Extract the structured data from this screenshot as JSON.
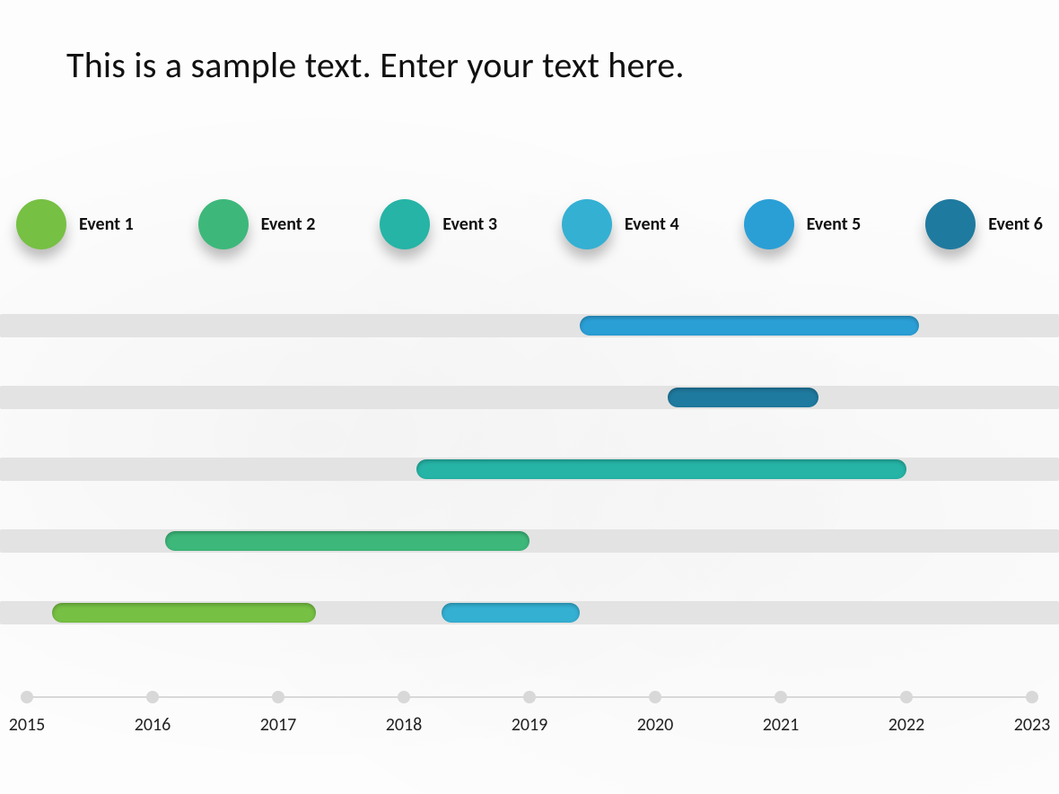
{
  "title": "This is a sample text. Enter your text here.",
  "legend": [
    {
      "label": "Event 1",
      "color": "#76c043"
    },
    {
      "label": "Event 2",
      "color": "#3db87a"
    },
    {
      "label": "Event 3",
      "color": "#25b4a6"
    },
    {
      "label": "Event 4",
      "color": "#34b0d3"
    },
    {
      "label": "Event 5",
      "color": "#2a9fd6"
    },
    {
      "label": "Event 6",
      "color": "#1f7a9f"
    }
  ],
  "axis": {
    "start": 2015,
    "end": 2023,
    "labels": [
      "2015",
      "2016",
      "2017",
      "2018",
      "2019",
      "2020",
      "2021",
      "2022",
      "2023"
    ]
  },
  "chart_data": {
    "type": "bar",
    "title": "This is a sample text. Enter your text here.",
    "xlabel": "",
    "ylabel": "",
    "x_range": [
      2015,
      2023
    ],
    "series": [
      {
        "row": 1,
        "segments": [
          {
            "event": "Event 5",
            "start": 2019.4,
            "end": 2022.1,
            "color": "#2a9fd6"
          }
        ]
      },
      {
        "row": 2,
        "segments": [
          {
            "event": "Event 6",
            "start": 2020.1,
            "end": 2021.3,
            "color": "#1f7a9f"
          }
        ]
      },
      {
        "row": 3,
        "segments": [
          {
            "event": "Event 3",
            "start": 2018.1,
            "end": 2022.0,
            "color": "#25b4a6"
          }
        ]
      },
      {
        "row": 4,
        "segments": [
          {
            "event": "Event 2",
            "start": 2016.1,
            "end": 2019.0,
            "color": "#3db87a"
          }
        ]
      },
      {
        "row": 5,
        "segments": [
          {
            "event": "Event 1",
            "start": 2015.2,
            "end": 2017.3,
            "color": "#76c043"
          },
          {
            "event": "Event 4",
            "start": 2018.3,
            "end": 2019.4,
            "color": "#34b0d3"
          }
        ]
      }
    ]
  }
}
